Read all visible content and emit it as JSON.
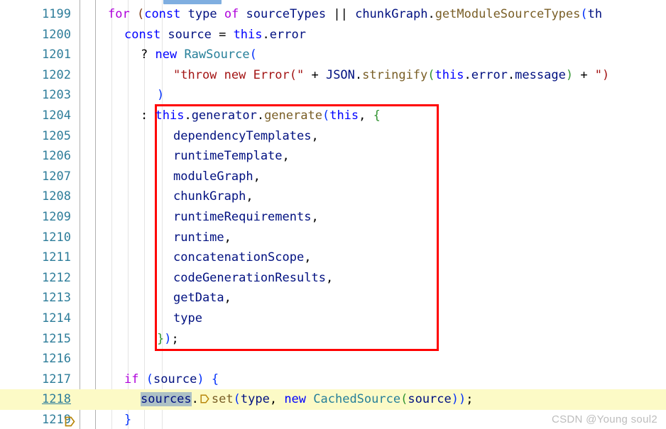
{
  "editor": {
    "language": "javascript",
    "first_line": 1199,
    "last_line": 1219,
    "highlighted_line": 1218,
    "selected_word": "sources",
    "colors": {
      "background": "#ffffff",
      "line_number": "#2E7D9A",
      "current_line_highlight": "#FCFAC6",
      "selection": "#ADC1C5",
      "annotation_box": "#FF0000",
      "keyword": "#0000FF",
      "control_keyword": "#AF00DB",
      "identifier": "#001080",
      "function": "#795E26",
      "type": "#267F99",
      "string": "#A31515",
      "bracket_0": "#0431FA",
      "bracket_1": "#319331",
      "bracket_2": "#7B3814",
      "marker": "#B8860B",
      "indent_guide": "#e4e4e4"
    }
  },
  "lines": [
    {
      "n": "1199",
      "marker": false,
      "highlight": false,
      "indent": 1
    },
    {
      "n": "1200",
      "marker": false,
      "highlight": false,
      "indent": 2
    },
    {
      "n": "1201",
      "marker": false,
      "highlight": false,
      "indent": 3
    },
    {
      "n": "1202",
      "marker": false,
      "highlight": false,
      "indent": 4
    },
    {
      "n": "1203",
      "marker": false,
      "highlight": false,
      "indent": 3
    },
    {
      "n": "1204",
      "marker": false,
      "highlight": false,
      "indent": 3
    },
    {
      "n": "1205",
      "marker": false,
      "highlight": false,
      "indent": 4
    },
    {
      "n": "1206",
      "marker": false,
      "highlight": false,
      "indent": 4
    },
    {
      "n": "1207",
      "marker": false,
      "highlight": false,
      "indent": 4
    },
    {
      "n": "1208",
      "marker": false,
      "highlight": false,
      "indent": 4
    },
    {
      "n": "1209",
      "marker": false,
      "highlight": false,
      "indent": 4
    },
    {
      "n": "1210",
      "marker": false,
      "highlight": false,
      "indent": 4
    },
    {
      "n": "1211",
      "marker": false,
      "highlight": false,
      "indent": 4
    },
    {
      "n": "1212",
      "marker": false,
      "highlight": false,
      "indent": 4
    },
    {
      "n": "1213",
      "marker": false,
      "highlight": false,
      "indent": 4
    },
    {
      "n": "1214",
      "marker": false,
      "highlight": false,
      "indent": 4
    },
    {
      "n": "1215",
      "marker": false,
      "highlight": false,
      "indent": 3
    },
    {
      "n": "1216",
      "marker": false,
      "highlight": false,
      "indent": 0
    },
    {
      "n": "1217",
      "marker": false,
      "highlight": false,
      "indent": 2
    },
    {
      "n": "1218",
      "marker": true,
      "highlight": true,
      "indent": 3
    },
    {
      "n": "1219",
      "marker": false,
      "highlight": false,
      "indent": 2
    }
  ],
  "code": {
    "l1199": {
      "kw_for": "for",
      "paren_open": " (",
      "kw_const": "const",
      "v_type": " type ",
      "kw_of": "of",
      "v_sourceTypes": " sourceTypes ",
      "op_or": "||",
      "v_chunkGraph": " chunkGraph",
      "dot1": ".",
      "fn_getModuleSourceTypes": "getModuleSourceTypes",
      "paren2": "(",
      "v_th": "th"
    },
    "l1200": {
      "kw_const": "const",
      "v_source": " source ",
      "op_eq": "=",
      "v_this": " this",
      "dot": ".",
      "v_error": "error"
    },
    "l1201": {
      "op_q": "?",
      "kw_new": " new",
      "t_RawSource": " RawSource",
      "paren": "("
    },
    "l1202": {
      "str1": "\"throw new Error(\"",
      "op_plus": " + ",
      "v_JSON": "JSON",
      "dot1": ".",
      "fn_stringify": "stringify",
      "paren_open": "(",
      "v_this": "this",
      "dot2": ".",
      "v_error": "error",
      "dot3": ".",
      "v_message": "message",
      "paren_close": ")",
      "op_plus2": " + ",
      "str2": "\")"
    },
    "l1203": {
      "paren_close": ")"
    },
    "l1204": {
      "colon": ": ",
      "v_this": "this",
      "dot1": ".",
      "v_generator": "generator",
      "dot2": ".",
      "fn_generate": "generate",
      "paren_open": "(",
      "v_this2": "this",
      "comma": ", ",
      "brace_open": "{"
    },
    "l1205": {
      "prop": "dependencyTemplates",
      "comma": ","
    },
    "l1206": {
      "prop": "runtimeTemplate",
      "comma": ","
    },
    "l1207": {
      "prop": "moduleGraph",
      "comma": ","
    },
    "l1208": {
      "prop": "chunkGraph",
      "comma": ","
    },
    "l1209": {
      "prop": "runtimeRequirements",
      "comma": ","
    },
    "l1210": {
      "prop": "runtime",
      "comma": ","
    },
    "l1211": {
      "prop": "concatenationScope",
      "comma": ","
    },
    "l1212": {
      "prop": "codeGenerationResults",
      "comma": ","
    },
    "l1213": {
      "prop": "getData",
      "comma": ","
    },
    "l1214": {
      "prop": "type",
      "comma": ""
    },
    "l1215": {
      "brace_close": "}",
      "paren_close": ")",
      "semi": ";"
    },
    "l1216": {
      "blank": ""
    },
    "l1217": {
      "kw_if": "if",
      "paren_open": " (",
      "v_source": "source",
      "paren_close": ")",
      "brace_open": " {"
    },
    "l1218": {
      "v_sources": "sources",
      "dot": ".",
      "fn_set": "set",
      "paren_open": "(",
      "v_type": "type",
      "comma": ", ",
      "kw_new": "new",
      "t_CachedSource": " CachedSource",
      "paren2": "(",
      "v_source": "source",
      "paren_close": "))",
      "semi": ";"
    },
    "l1219": {
      "brace_close": "}"
    }
  },
  "annotation": {
    "box_label": "red-highlight-rectangle"
  },
  "watermark": {
    "text": "CSDN @Young soul2"
  }
}
